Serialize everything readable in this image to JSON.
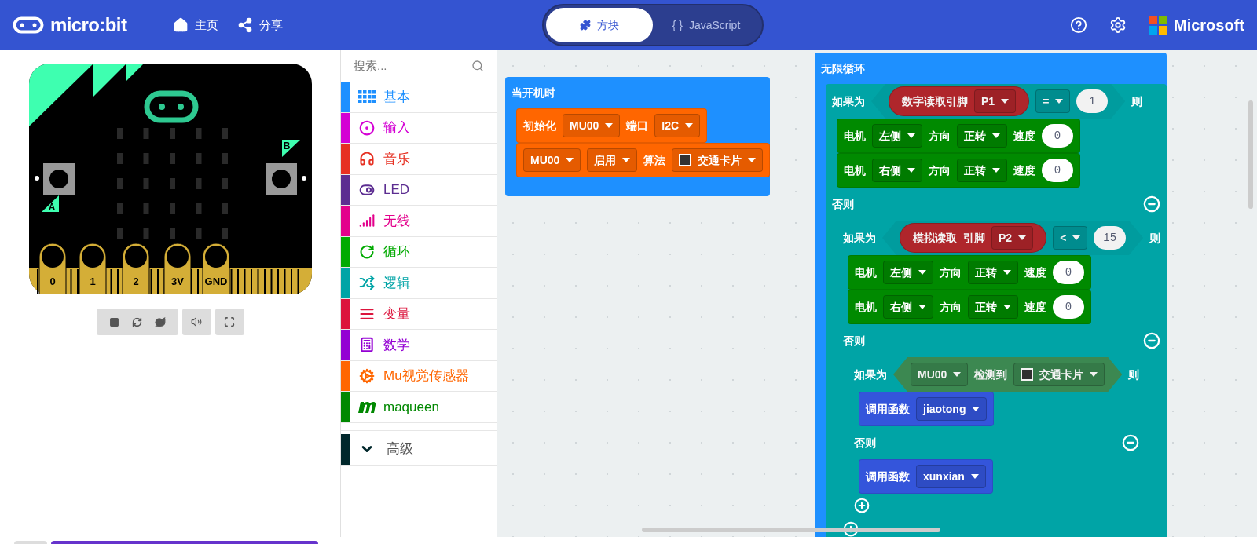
{
  "header": {
    "logo": "micro:bit",
    "nav": [
      {
        "label": "主页",
        "kind": "home"
      },
      {
        "label": "分享",
        "kind": "share"
      }
    ],
    "tabs": [
      {
        "label": "方块",
        "kind": "blocks",
        "selected": true
      },
      {
        "label": "JavaScript",
        "prefix": "{ }",
        "kind": "code",
        "selected": false
      }
    ],
    "brand": "Microsoft"
  },
  "simulator": {
    "pins": [
      "0",
      "1",
      "2",
      "3V",
      "GND"
    ],
    "buttons": [
      "A",
      "B"
    ]
  },
  "toolbox": {
    "search": {
      "placeholder": "搜索..."
    },
    "categories": [
      {
        "label": "基本",
        "color": "#1e90ff",
        "kind": "grid"
      },
      {
        "label": "输入",
        "color": "#d400d4",
        "kind": "target"
      },
      {
        "label": "音乐",
        "color": "#e63022",
        "kind": "headphones"
      },
      {
        "label": "LED",
        "color": "#5c2d91",
        "kind": "toggle"
      },
      {
        "label": "无线",
        "color": "#e3008c",
        "kind": "signal"
      },
      {
        "label": "循环",
        "color": "#00aa00",
        "kind": "loop"
      },
      {
        "label": "逻辑",
        "color": "#00a4a6",
        "kind": "shuffle"
      },
      {
        "label": "变量",
        "color": "#dc143c",
        "kind": "bars"
      },
      {
        "label": "数学",
        "color": "#9400d3",
        "kind": "calculator"
      },
      {
        "label": "Mu视觉传感器",
        "color": "#ff6600",
        "kind": "gears"
      },
      {
        "label": "maqueen",
        "color": "#008800",
        "kind": "m"
      }
    ],
    "advanced": {
      "label": "高级",
      "color": "#00272b"
    }
  },
  "canvas": {
    "stacks": [
      {
        "kind": "event",
        "label": "当开机时",
        "color": "#1e90ff",
        "body": [
          {
            "kind": "statement",
            "color": "#ff6600",
            "parts": [
              {
                "kind": "label",
                "text": "初始化"
              },
              {
                "kind": "dropdown",
                "text": "MU00"
              },
              {
                "kind": "label",
                "text": "端口"
              },
              {
                "kind": "dropdown",
                "text": "I2C"
              }
            ]
          },
          {
            "kind": "statement",
            "color": "#ff6600",
            "parts": [
              {
                "kind": "dropdown",
                "text": "MU00"
              },
              {
                "kind": "dropdown",
                "text": "启用"
              },
              {
                "kind": "label",
                "text": "算法"
              },
              {
                "kind": "swatch",
                "text": "交通卡片"
              }
            ]
          }
        ]
      },
      {
        "kind": "loop",
        "label": "无限循环",
        "color": "#1e90ff",
        "body": [
          {
            "kind": "if",
            "color": "#00a4a6",
            "sections": [
              {
                "kind": "cond",
                "parts": [
                  {
                    "kind": "label",
                    "text": "如果为"
                  },
                  {
                    "kind": "hexagon",
                    "color": "#00a4a6",
                    "parts": [
                      {
                        "kind": "reporter",
                        "color": "#b8282d",
                        "parts": [
                          {
                            "kind": "label",
                            "text": "数字读取引脚"
                          },
                          {
                            "kind": "dropdown",
                            "text": "P1"
                          }
                        ]
                      },
                      {
                        "kind": "dropdown",
                        "text": "="
                      },
                      {
                        "kind": "number",
                        "text": "1"
                      }
                    ]
                  },
                  {
                    "kind": "label",
                    "text": "则"
                  }
                ],
                "body": [
                  {
                    "kind": "statement",
                    "color": "#008a00",
                    "parts": [
                      {
                        "kind": "label",
                        "text": "电机"
                      },
                      {
                        "kind": "dropdown",
                        "text": "左侧"
                      },
                      {
                        "kind": "label",
                        "text": "方向"
                      },
                      {
                        "kind": "dropdown",
                        "text": "正转"
                      },
                      {
                        "kind": "label",
                        "text": "速度"
                      },
                      {
                        "kind": "number",
                        "text": "0"
                      }
                    ]
                  },
                  {
                    "kind": "statement",
                    "color": "#008a00",
                    "parts": [
                      {
                        "kind": "label",
                        "text": "电机"
                      },
                      {
                        "kind": "dropdown",
                        "text": "右侧"
                      },
                      {
                        "kind": "label",
                        "text": "方向"
                      },
                      {
                        "kind": "dropdown",
                        "text": "正转"
                      },
                      {
                        "kind": "label",
                        "text": "速度"
                      },
                      {
                        "kind": "number",
                        "text": "0"
                      }
                    ]
                  }
                ]
              },
              {
                "kind": "else",
                "label": "否则",
                "body": [
                  {
                    "kind": "if",
                    "color": "#00a4a6",
                    "sections": [
                      {
                        "kind": "cond",
                        "parts": [
                          {
                            "kind": "label",
                            "text": "如果为"
                          },
                          {
                            "kind": "hexagon",
                            "color": "#00a4a6",
                            "parts": [
                              {
                                "kind": "reporter",
                                "color": "#b8282d",
                                "parts": [
                                  {
                                    "kind": "label",
                                    "text": "模拟读取"
                                  },
                                  {
                                    "kind": "label",
                                    "text": "引脚"
                                  },
                                  {
                                    "kind": "dropdown",
                                    "text": "P2"
                                  }
                                ]
                              },
                              {
                                "kind": "dropdown",
                                "text": "<"
                              },
                              {
                                "kind": "number",
                                "text": "15"
                              }
                            ]
                          },
                          {
                            "kind": "label",
                            "text": "则"
                          }
                        ],
                        "body": [
                          {
                            "kind": "statement",
                            "color": "#008a00",
                            "parts": [
                              {
                                "kind": "label",
                                "text": "电机"
                              },
                              {
                                "kind": "dropdown",
                                "text": "左侧"
                              },
                              {
                                "kind": "label",
                                "text": "方向"
                              },
                              {
                                "kind": "dropdown",
                                "text": "正转"
                              },
                              {
                                "kind": "label",
                                "text": "速度"
                              },
                              {
                                "kind": "number",
                                "text": "0"
                              }
                            ]
                          },
                          {
                            "kind": "statement",
                            "color": "#008a00",
                            "parts": [
                              {
                                "kind": "label",
                                "text": "电机"
                              },
                              {
                                "kind": "dropdown",
                                "text": "右侧"
                              },
                              {
                                "kind": "label",
                                "text": "方向"
                              },
                              {
                                "kind": "dropdown",
                                "text": "正转"
                              },
                              {
                                "kind": "label",
                                "text": "速度"
                              },
                              {
                                "kind": "number",
                                "text": "0"
                              }
                            ]
                          }
                        ]
                      },
                      {
                        "kind": "else",
                        "label": "否则",
                        "body": [
                          {
                            "kind": "if",
                            "color": "#00a4a6",
                            "sections": [
                              {
                                "kind": "cond",
                                "parts": [
                                  {
                                    "kind": "label",
                                    "text": "如果为"
                                  },
                                  {
                                    "kind": "hexagon",
                                    "color": "#3f8f55",
                                    "parts": [
                                      {
                                        "kind": "dropdown",
                                        "text": "MU00"
                                      },
                                      {
                                        "kind": "label",
                                        "text": "检测到"
                                      },
                                      {
                                        "kind": "swatch",
                                        "text": "交通卡片"
                                      }
                                    ]
                                  },
                                  {
                                    "kind": "label",
                                    "text": "则"
                                  }
                                ],
                                "body": [
                                  {
                                    "kind": "statement",
                                    "color": "#3455db",
                                    "parts": [
                                      {
                                        "kind": "label",
                                        "text": "调用函数"
                                      },
                                      {
                                        "kind": "dropdown",
                                        "text": "jiaotong"
                                      }
                                    ]
                                  }
                                ]
                              },
                              {
                                "kind": "else",
                                "label": "否则",
                                "body": [
                                  {
                                    "kind": "statement",
                                    "color": "#3455db",
                                    "parts": [
                                      {
                                        "kind": "label",
                                        "text": "调用函数"
                                      },
                                      {
                                        "kind": "dropdown",
                                        "text": "xunxian"
                                      }
                                    ]
                                  }
                                ]
                              },
                              {
                                "kind": "add"
                              }
                            ]
                          }
                        ]
                      },
                      {
                        "kind": "add"
                      }
                    ]
                  }
                ]
              }
            ]
          }
        ]
      }
    ]
  }
}
